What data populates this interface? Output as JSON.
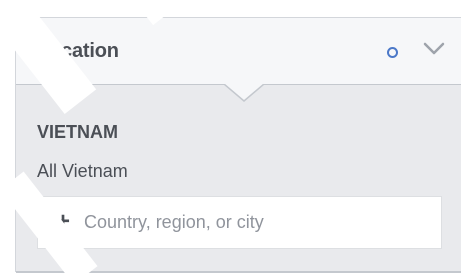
{
  "location_panel": {
    "title": "Location",
    "country_name": "VIETNAM",
    "country_scope": "All Vietnam",
    "search_placeholder": "Country, region, or city",
    "add_icon": "plus-icon",
    "status_icon": "dot-icon",
    "toggle_icon": "chevron-down-icon"
  },
  "colors": {
    "panel_bg": "#e9eaed",
    "header_bg": "#f6f7f9",
    "text": "#4b4f56",
    "accent": "#4b78c8",
    "placeholder": "#90949c"
  }
}
